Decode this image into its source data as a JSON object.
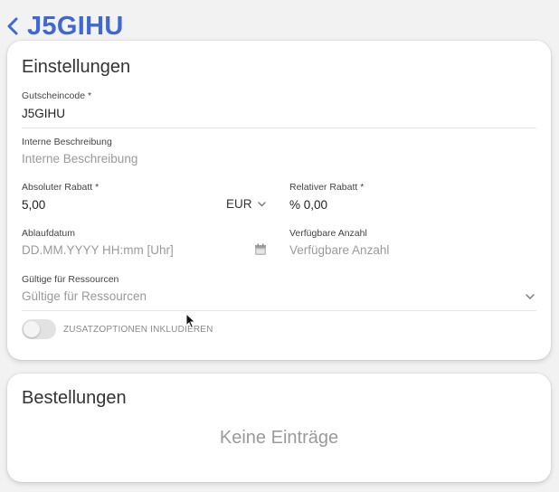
{
  "header": {
    "title": "J5GIHU"
  },
  "settings": {
    "title": "Einstellungen",
    "voucher_code": {
      "label": "Gutscheincode *",
      "value": "J5GIHU"
    },
    "internal_description": {
      "label": "Interne Beschreibung",
      "placeholder": "Interne Beschreibung"
    },
    "absolute_discount": {
      "label": "Absoluter Rabatt *",
      "value": "5,00",
      "currency": "EUR"
    },
    "relative_discount": {
      "label": "Relativer Rabatt *",
      "value": "% 0,00"
    },
    "expiry_date": {
      "label": "Ablaufdatum",
      "placeholder": "DD.MM.YYYY HH:mm [Uhr]"
    },
    "available_count": {
      "label": "Verfügbare Anzahl",
      "placeholder": "Verfügbare Anzahl"
    },
    "valid_resources": {
      "label": "Gültige für Ressourcen",
      "placeholder": "Gültige für Ressourcen"
    },
    "include_extras": {
      "label": "ZUSATZOPTIONEN INKLUDIEREN",
      "enabled": false
    }
  },
  "orders": {
    "title": "Bestellungen",
    "empty_text": "Keine Einträge"
  },
  "colors": {
    "accent": "#3f68d1",
    "background": "#f2f2f2",
    "card": "#ffffff"
  }
}
